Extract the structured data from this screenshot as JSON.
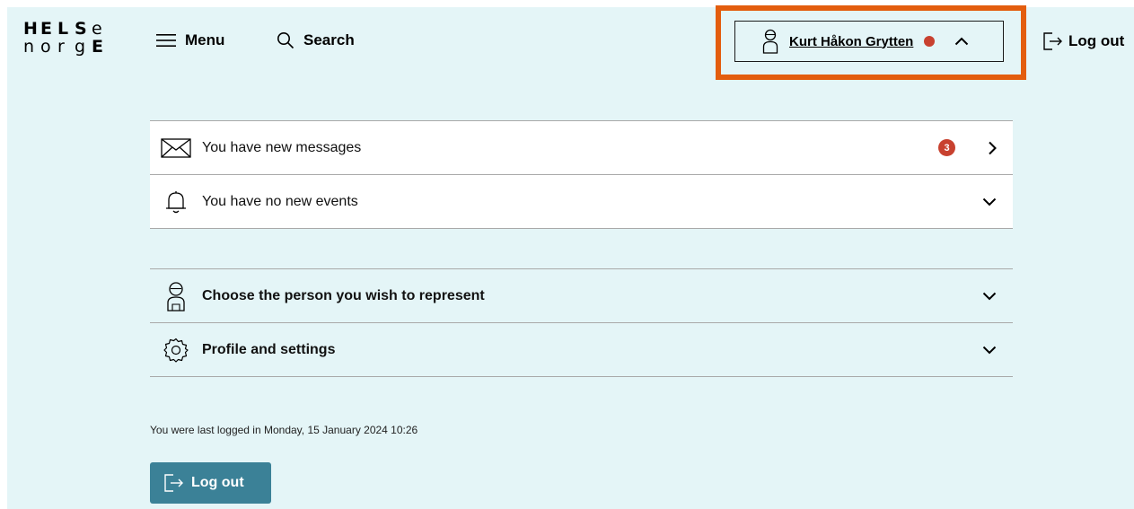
{
  "logo": {
    "row1": [
      "H",
      "E",
      "L",
      "S",
      "e"
    ],
    "row2": [
      "n",
      "o",
      "r",
      "g",
      "E"
    ]
  },
  "header": {
    "menu_label": "Menu",
    "search_label": "Search",
    "user_name": "Kurt Håkon Grytten",
    "logout_label": "Log out"
  },
  "notifications": {
    "messages_label": "You have new messages",
    "messages_count": "3",
    "events_label": "You have no new events"
  },
  "options": {
    "represent_label": "Choose the person you wish to represent",
    "profile_label": "Profile and settings"
  },
  "footer": {
    "last_login": "You were last logged in Monday, 15 January 2024 10:26",
    "logout_label": "Log out"
  },
  "colors": {
    "background": "#e4f5f7",
    "accent": "#3b8197",
    "badge": "#c8412f",
    "highlight": "#e35d0e"
  }
}
